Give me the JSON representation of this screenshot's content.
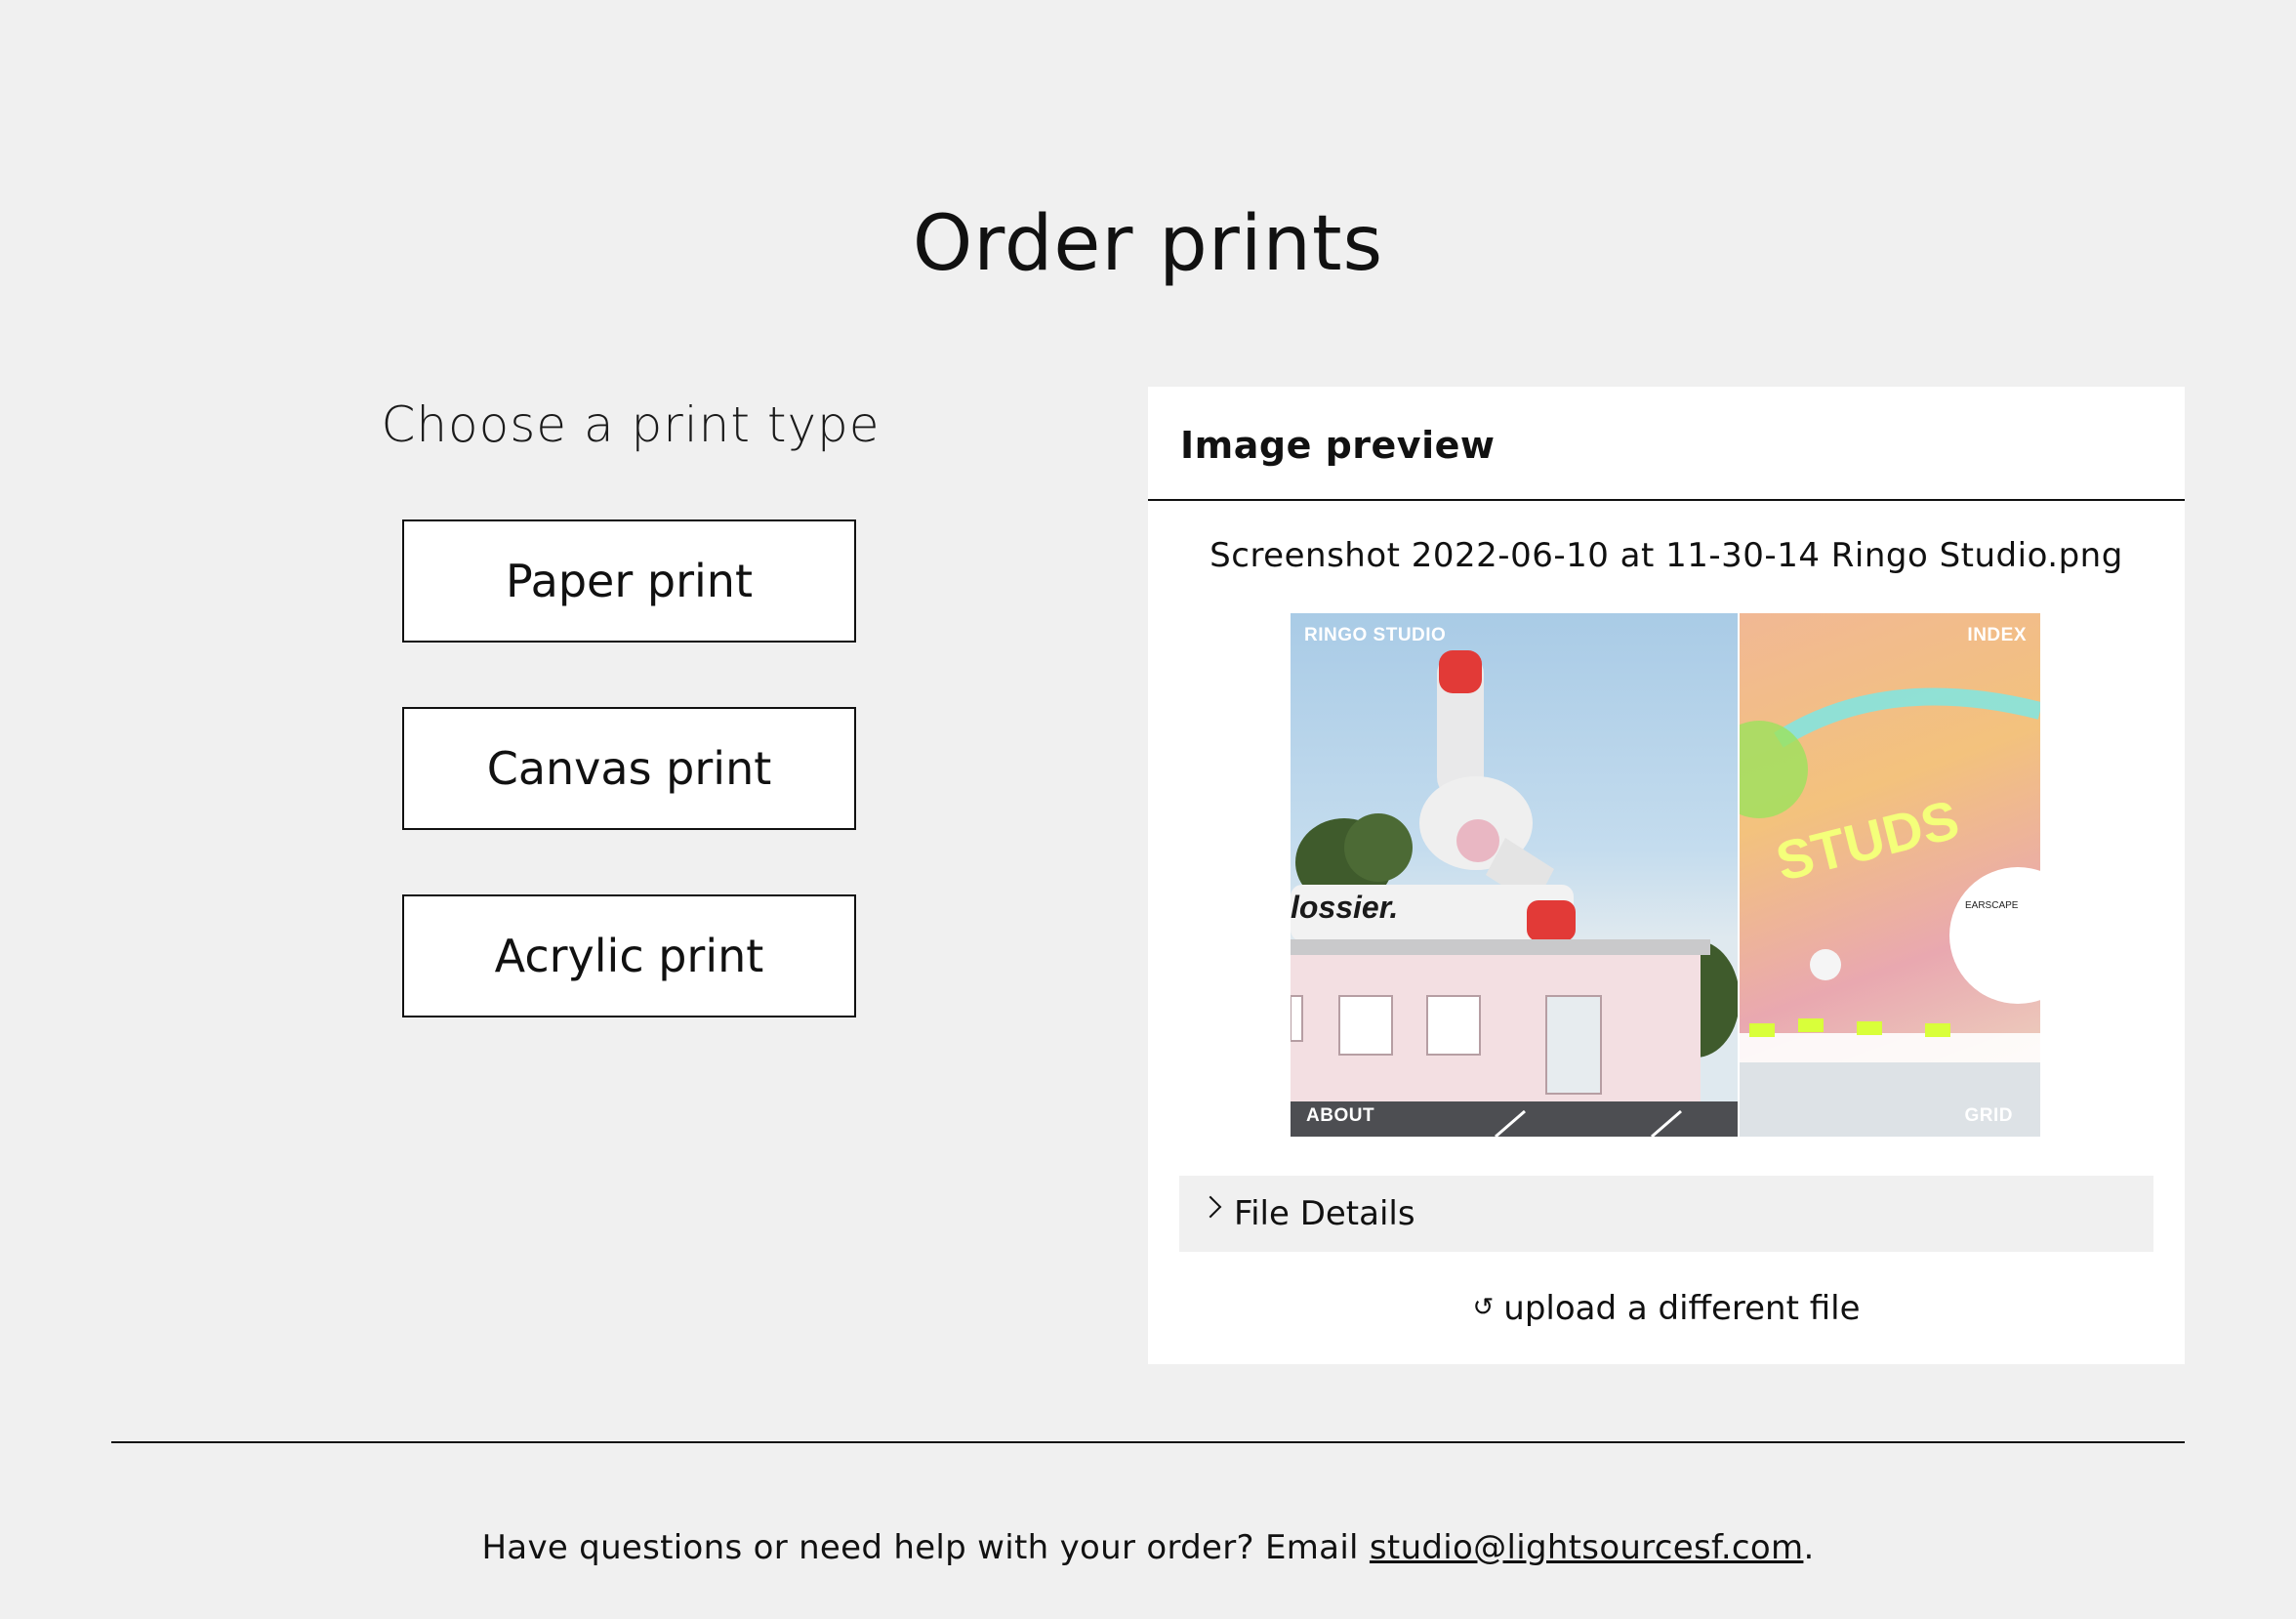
{
  "page": {
    "title": "Order prints"
  },
  "print_types": {
    "heading": "Choose a print type",
    "options": [
      {
        "label": "Paper print"
      },
      {
        "label": "Canvas print"
      },
      {
        "label": "Acrylic print"
      }
    ]
  },
  "preview": {
    "header": "Image preview",
    "file_name": "Screenshot 2022-06-10 at 11-30-14 Ringo Studio.png",
    "image_overlay_labels": {
      "top_left": "RINGO STUDIO",
      "top_right": "INDEX",
      "bottom_left": "ABOUT",
      "bottom_right": "GRID"
    },
    "image_content_text": {
      "brand": "lossier.",
      "sign": "STUDS",
      "poster_title": "EARSCAPE"
    },
    "file_details_label": "File Details",
    "upload_label": "upload a different file",
    "icons": {
      "details_toggle": "chevron-right-icon",
      "upload": "reload-icon"
    }
  },
  "footer": {
    "text_prefix": "Have questions or need help with your order? Email ",
    "email": "studio@lightsourcesf.com",
    "text_suffix": "."
  },
  "colors": {
    "background": "#f0f0f0",
    "card": "#ffffff",
    "text": "#111111"
  }
}
